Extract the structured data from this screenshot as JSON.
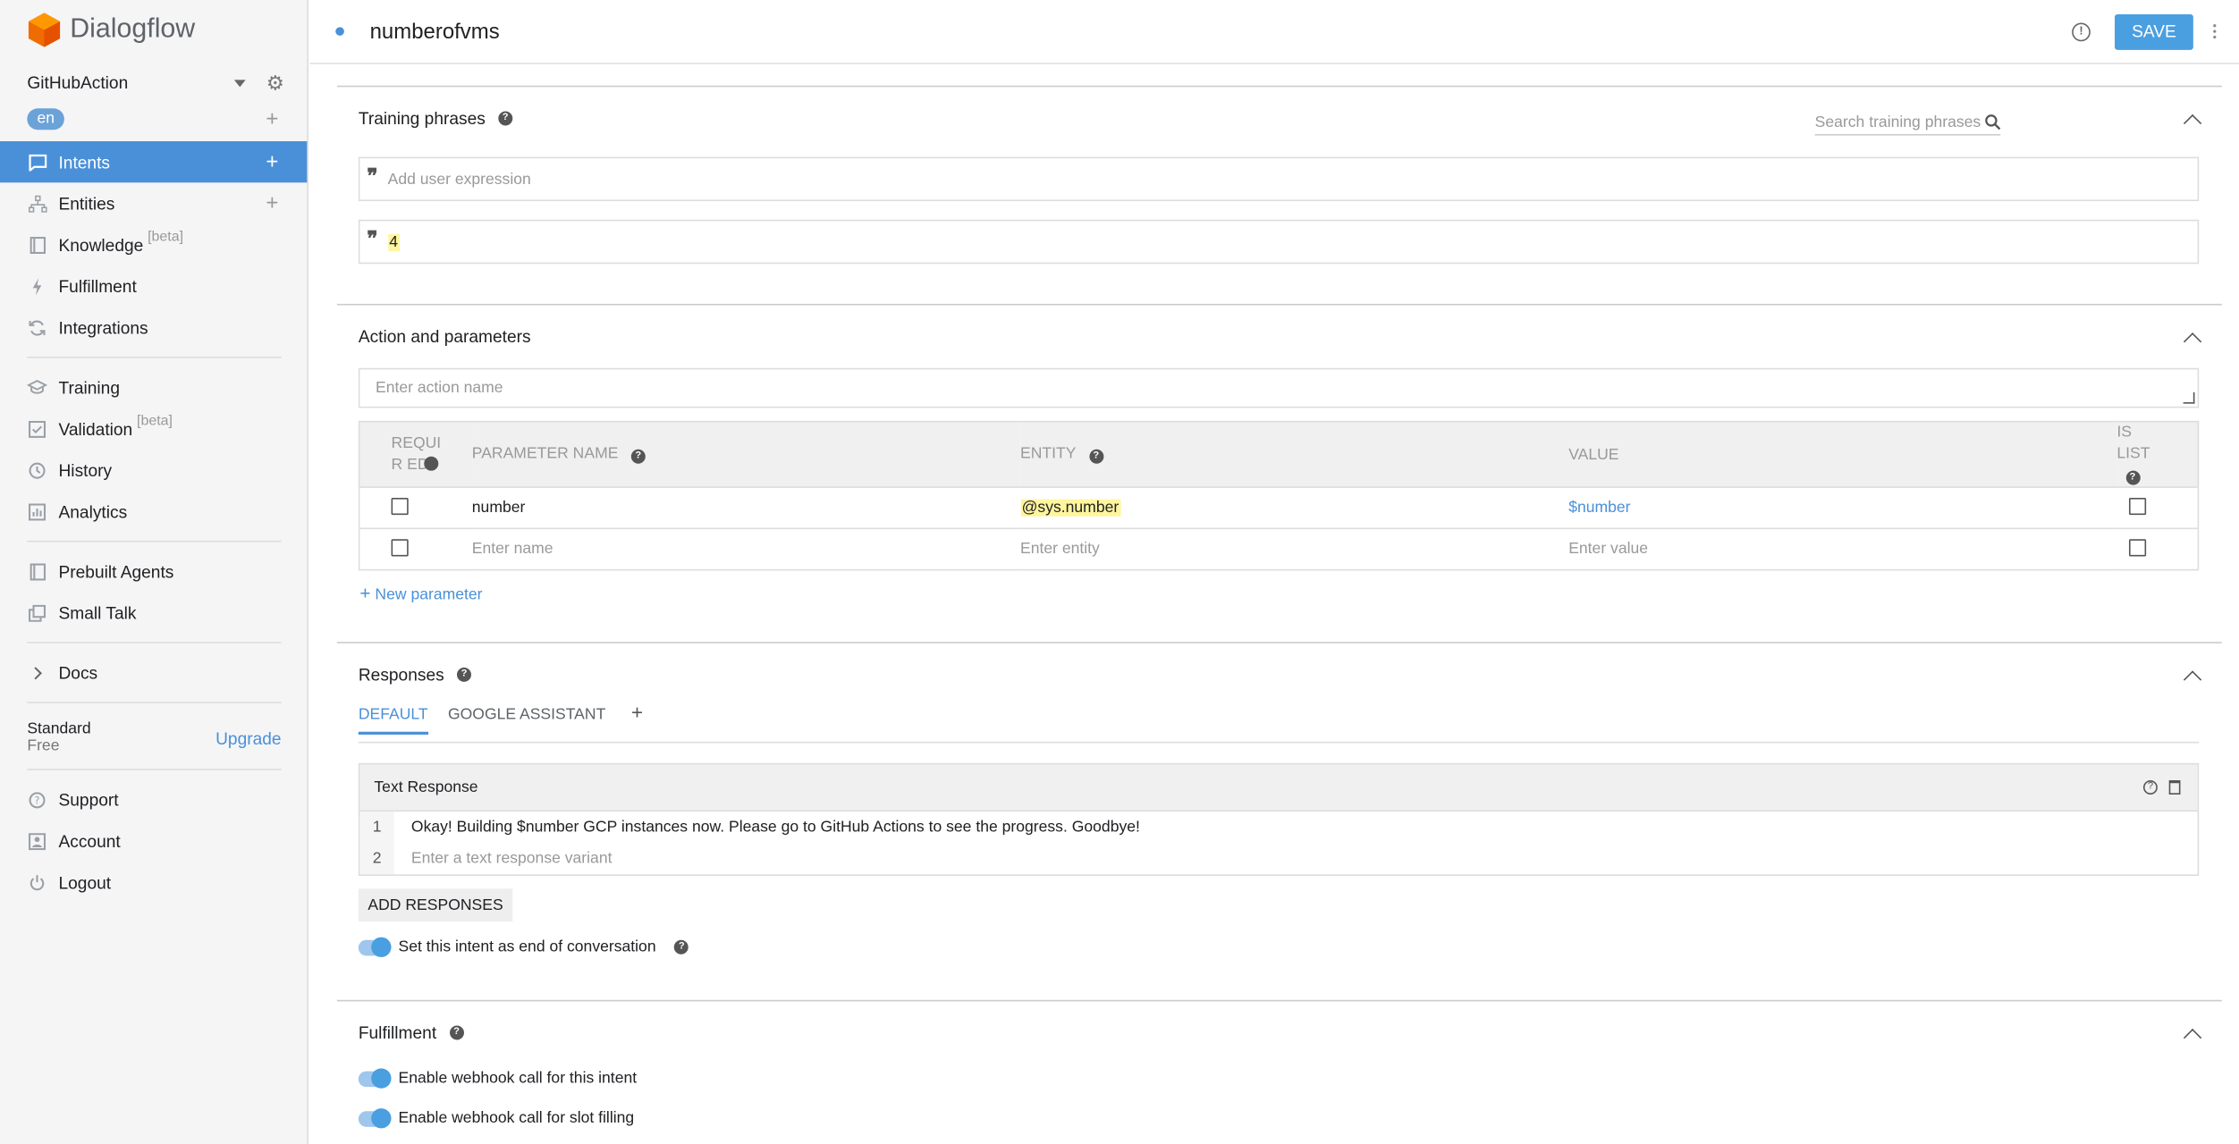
{
  "app": {
    "name": "Dialogflow"
  },
  "sidebar": {
    "agent": "GitHubAction",
    "language": "en",
    "items": [
      {
        "label": "Intents",
        "icon": "chat-icon"
      },
      {
        "label": "Entities",
        "icon": "entities-icon"
      },
      {
        "label": "Knowledge",
        "icon": "book-icon",
        "badge": "[beta]"
      },
      {
        "label": "Fulfillment",
        "icon": "bolt-icon"
      },
      {
        "label": "Integrations",
        "icon": "sync-icon"
      },
      {
        "label": "Training",
        "icon": "graduation-icon"
      },
      {
        "label": "Validation",
        "icon": "check-box-icon",
        "badge": "[beta]"
      },
      {
        "label": "History",
        "icon": "clock-icon"
      },
      {
        "label": "Analytics",
        "icon": "bar-chart-icon"
      },
      {
        "label": "Prebuilt Agents",
        "icon": "book-icon"
      },
      {
        "label": "Small Talk",
        "icon": "copy-icon"
      },
      {
        "label": "Docs",
        "icon": "chevron-right-icon"
      }
    ],
    "plan": {
      "name": "Standard",
      "tier": "Free",
      "upgrade": "Upgrade"
    },
    "bottom": [
      {
        "label": "Support",
        "icon": "help-icon"
      },
      {
        "label": "Account",
        "icon": "account-icon"
      },
      {
        "label": "Logout",
        "icon": "power-icon"
      }
    ]
  },
  "topbar": {
    "intent_name": "numberofvms",
    "save": "SAVE"
  },
  "training": {
    "title": "Training phrases",
    "search_placeholder": "Search training phrases",
    "add_placeholder": "Add user expression",
    "phrases": [
      "4"
    ]
  },
  "action": {
    "title": "Action and parameters",
    "placeholder": "Enter action name",
    "headers": {
      "required": "REQUIR ED",
      "name": "PARAMETER NAME",
      "entity": "ENTITY",
      "value": "VALUE",
      "is_list": "IS LIST"
    },
    "rows": [
      {
        "name": "number",
        "entity": "@sys.number",
        "value": "$number"
      }
    ],
    "empty_row": {
      "name": "Enter name",
      "entity": "Enter entity",
      "value": "Enter value"
    },
    "new_param": "New parameter"
  },
  "responses": {
    "title": "Responses",
    "tabs": [
      "DEFAULT",
      "GOOGLE ASSISTANT"
    ],
    "box_title": "Text Response",
    "lines": [
      {
        "n": "1",
        "text": "Okay! Building $number GCP instances now. Please go to GitHub Actions to see the progress. Goodbye!"
      },
      {
        "n": "2",
        "text": "Enter a text response variant"
      }
    ],
    "add": "ADD RESPONSES",
    "end_conversation": "Set this intent as end of conversation"
  },
  "fulfillment": {
    "title": "Fulfillment",
    "webhook_intent": "Enable webhook call for this intent",
    "webhook_slot": "Enable webhook call for slot filling"
  }
}
